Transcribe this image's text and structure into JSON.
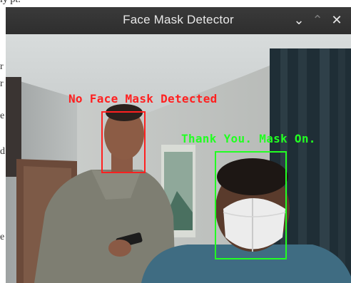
{
  "background": {
    "top_text": "ly pt.",
    "fragments": [
      "r",
      "r",
      "e",
      "d",
      "e"
    ]
  },
  "window": {
    "title": "Face Mask Detector",
    "buttons": {
      "minimize": "⌄",
      "maximize": "⌃",
      "close": "✕"
    }
  },
  "detections": [
    {
      "label": "No Face Mask Detected",
      "status": "no_mask",
      "color": "#ff2020"
    },
    {
      "label": "Thank You. Mask On.",
      "status": "mask_on",
      "color": "#22ff22"
    }
  ]
}
